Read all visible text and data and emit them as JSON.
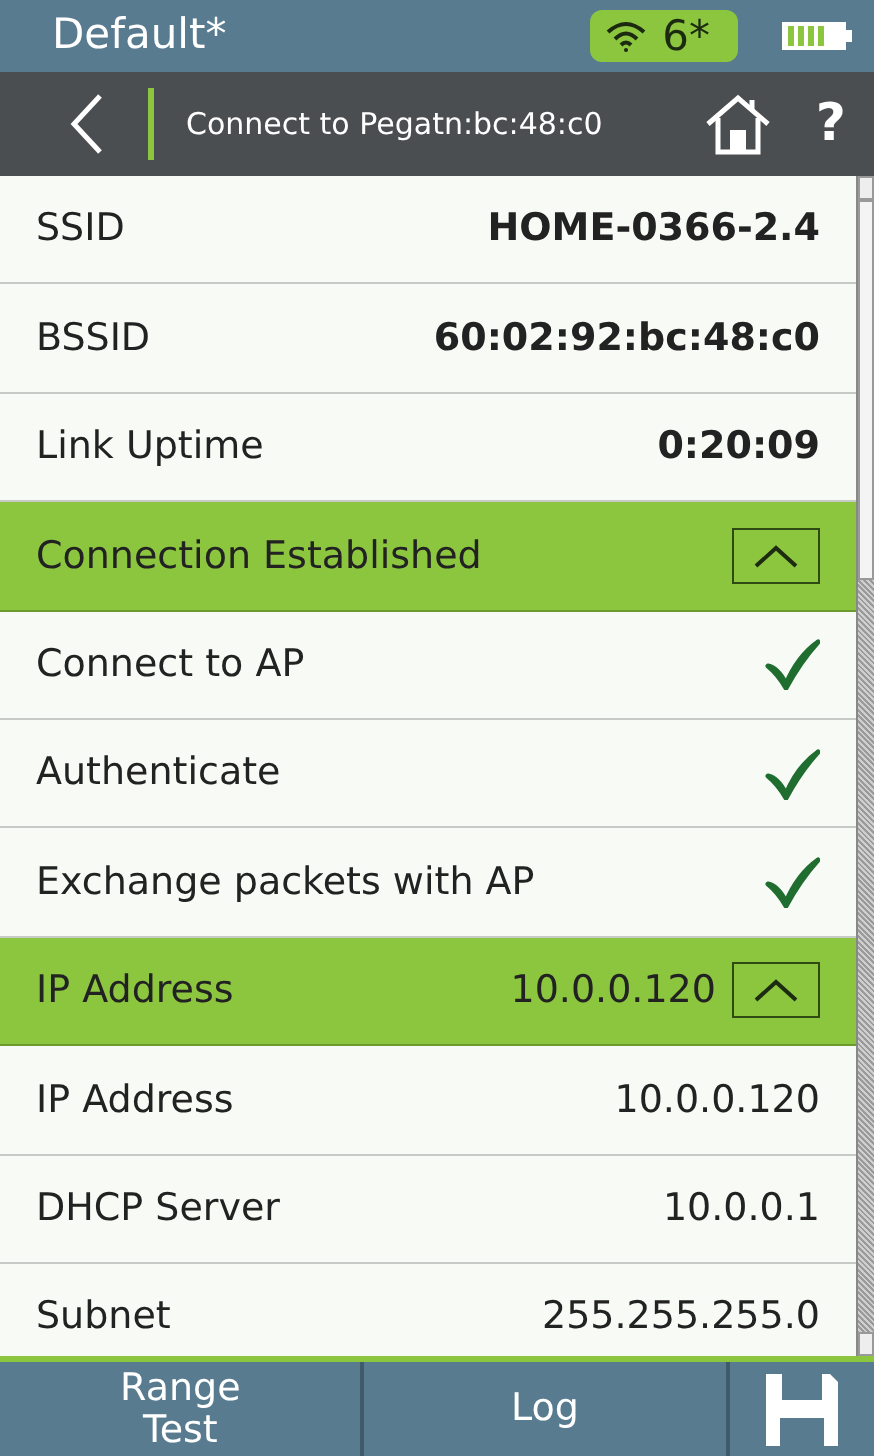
{
  "status_bar": {
    "title": "Default*",
    "wifi_channel": "6*"
  },
  "nav": {
    "title": "Connect to Pegatn:bc:48:c0",
    "help": "?"
  },
  "rows": [
    {
      "kind": "field",
      "label": "SSID",
      "value": "HOME-0366-2.4",
      "bold": true
    },
    {
      "kind": "field",
      "label": "BSSID",
      "value": "60:02:92:bc:48:c0",
      "bold": true
    },
    {
      "kind": "field",
      "label": "Link Uptime",
      "value": "0:20:09",
      "bold": true
    },
    {
      "kind": "section",
      "label": "Connection Established",
      "expanded": true
    },
    {
      "kind": "step",
      "label": "Connect to AP",
      "checked": true
    },
    {
      "kind": "step",
      "label": "Authenticate",
      "checked": true
    },
    {
      "kind": "step",
      "label": "Exchange packets with AP",
      "checked": true
    },
    {
      "kind": "section",
      "label": "IP Address",
      "value": "10.0.0.120",
      "expanded": true
    },
    {
      "kind": "field",
      "label": "IP Address",
      "value": "10.0.0.120",
      "bold": false
    },
    {
      "kind": "field",
      "label": "DHCP Server",
      "value": "10.0.0.1",
      "bold": false
    },
    {
      "kind": "field",
      "label": "Subnet",
      "value": "255.255.255.0",
      "bold": false
    }
  ],
  "toolbar": [
    {
      "kind": "text",
      "label": "Range Test"
    },
    {
      "kind": "text",
      "label": "Log"
    },
    {
      "kind": "save"
    }
  ]
}
